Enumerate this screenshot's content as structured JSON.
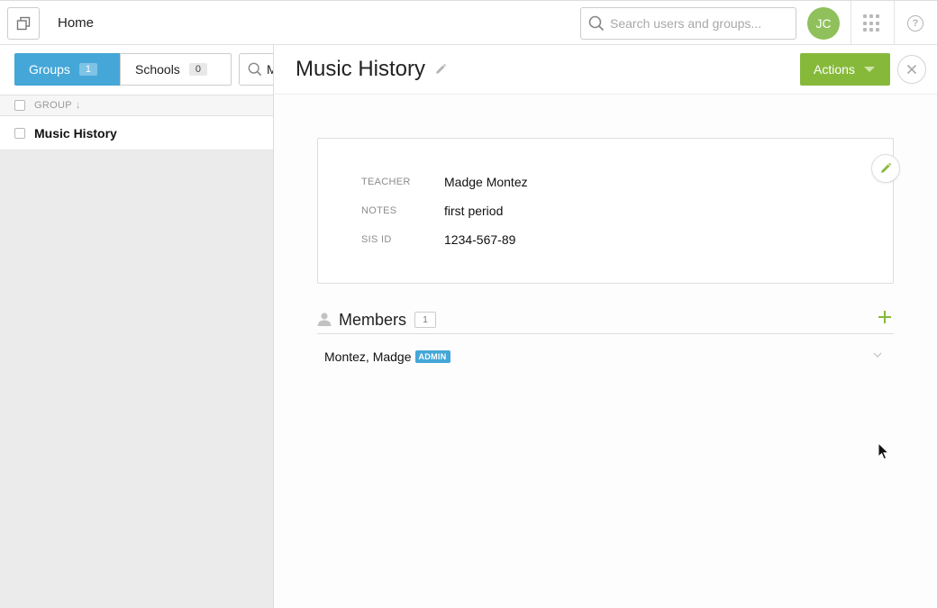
{
  "topbar": {
    "home_label": "Home",
    "search_placeholder": "Search users and groups...",
    "avatar_initials": "JC",
    "icons": [
      "window-stack-icon",
      "search-icon",
      "apps-grid-icon",
      "help-icon"
    ]
  },
  "left": {
    "tabs": [
      {
        "label": "Groups",
        "count": "1",
        "active": true
      },
      {
        "label": "Schools",
        "count": "0",
        "active": false
      }
    ],
    "search_value": "M",
    "list_header": "GROUP",
    "rows": [
      {
        "name": "Music History"
      }
    ]
  },
  "detail": {
    "title": "Music History",
    "actions_label": "Actions",
    "fields": [
      {
        "key": "TEACHER",
        "value": "Madge Montez"
      },
      {
        "key": "NOTES",
        "value": "first period"
      },
      {
        "key": "SIS ID",
        "value": "1234-567-89"
      }
    ],
    "members": {
      "title": "Members",
      "count": "1",
      "items": [
        {
          "name": "Montez, Madge",
          "badge": "ADMIN"
        }
      ]
    }
  },
  "colors": {
    "accent_blue": "#44a7d8",
    "actions_green": "#86b93a",
    "avatar_green": "#8fc05b",
    "plus_green": "#86b93a"
  }
}
